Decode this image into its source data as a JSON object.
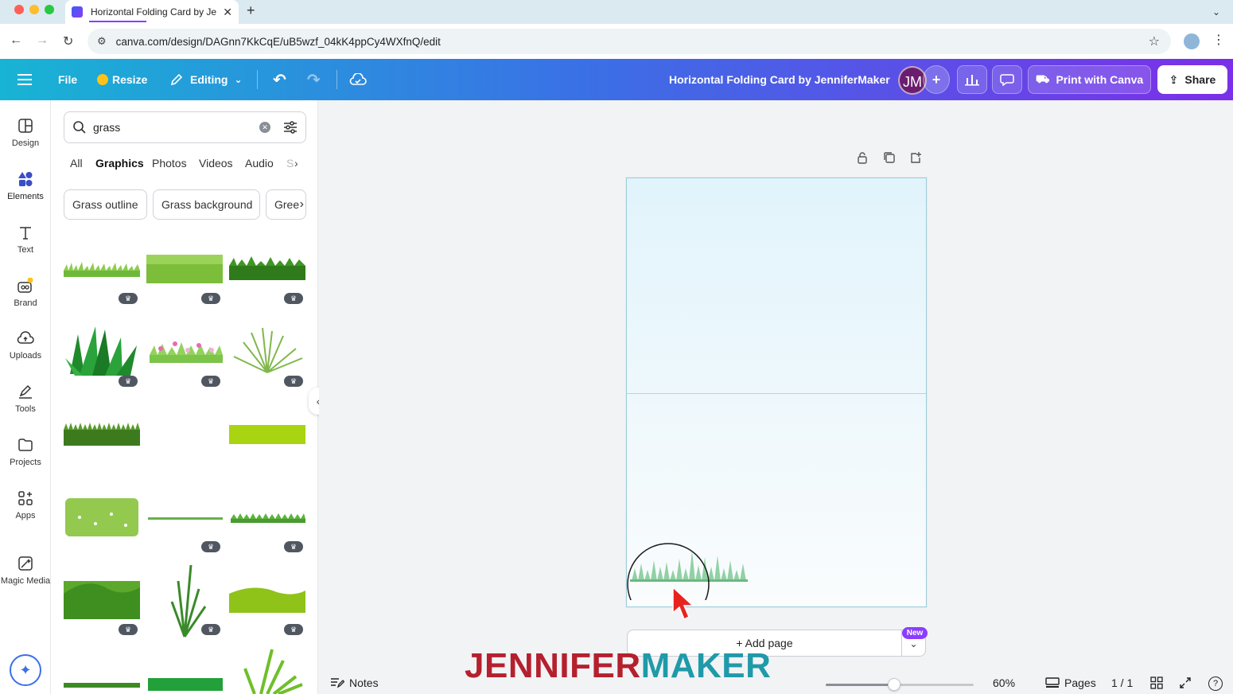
{
  "browser": {
    "tab_title": "Horizontal Folding Card by Je",
    "url": "canva.com/design/DAGnn7KkCqE/uB5wzf_04kK4ppCy4WXfnQ/edit"
  },
  "header": {
    "file_label": "File",
    "resize_label": "Resize",
    "editing_label": "Editing",
    "doc_title": "Horizontal Folding Card by JenniferMaker",
    "avatar_initials": "JM",
    "print_label": "Print with Canva",
    "share_label": "Share"
  },
  "rail": {
    "items": [
      {
        "label": "Design",
        "icon": "design-icon"
      },
      {
        "label": "Elements",
        "icon": "elements-icon"
      },
      {
        "label": "Text",
        "icon": "text-icon"
      },
      {
        "label": "Brand",
        "icon": "brand-icon"
      },
      {
        "label": "Uploads",
        "icon": "uploads-icon"
      },
      {
        "label": "Tools",
        "icon": "tools-icon"
      },
      {
        "label": "Projects",
        "icon": "projects-icon"
      },
      {
        "label": "Apps",
        "icon": "apps-icon"
      },
      {
        "label": "Magic Media",
        "icon": "magic-media-icon"
      }
    ]
  },
  "panel": {
    "search_value": "grass",
    "tabs": [
      "All",
      "Graphics",
      "Photos",
      "Videos",
      "Audio",
      "S"
    ],
    "active_tab": "Graphics",
    "chips": [
      "Grass outline",
      "Grass background",
      "Gree"
    ]
  },
  "canvas": {
    "add_page_label": "+ Add page",
    "new_badge": "New"
  },
  "footer": {
    "notes_label": "Notes",
    "zoom_level": "60%",
    "zoom_fraction": 0.46,
    "pages_label": "Pages",
    "page_count": "1 / 1"
  },
  "watermark": {
    "part1": "JENNIFER",
    "part2": "MAKER"
  },
  "colors": {
    "accent": "#8b3dff",
    "header_start": "#18b4d4",
    "header_end": "#7b2fe8"
  }
}
